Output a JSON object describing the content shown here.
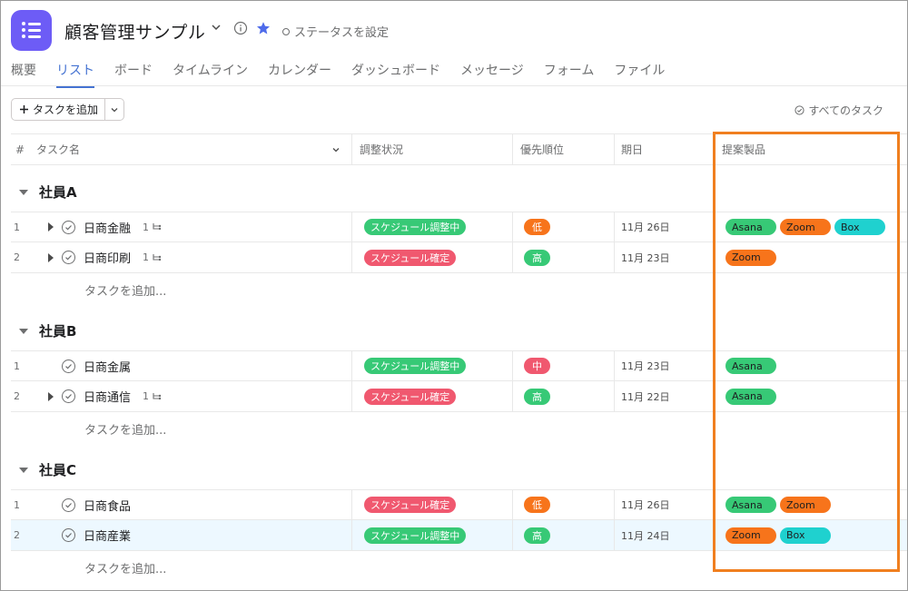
{
  "header": {
    "title": "顧客管理サンプル",
    "status_label": "ステータスを設定"
  },
  "tabs": [
    {
      "label": "概要",
      "active": false
    },
    {
      "label": "リスト",
      "active": true
    },
    {
      "label": "ボード",
      "active": false
    },
    {
      "label": "タイムライン",
      "active": false
    },
    {
      "label": "カレンダー",
      "active": false
    },
    {
      "label": "ダッシュボード",
      "active": false
    },
    {
      "label": "メッセージ",
      "active": false
    },
    {
      "label": "フォーム",
      "active": false
    },
    {
      "label": "ファイル",
      "active": false
    }
  ],
  "toolbar": {
    "add_task_label": "タスクを追加",
    "all_tasks_label": "すべてのタスク"
  },
  "columns": {
    "num": "#",
    "task": "タスク名",
    "status": "調整状況",
    "priority": "優先順位",
    "due": "期日",
    "products": "提案製品"
  },
  "add_task_row_label": "タスクを追加...",
  "colors": {
    "accent": "#4573d2",
    "highlight": "#f07f1f",
    "status_green": "#37c976",
    "status_red": "#f0586f",
    "orange": "#f7741b",
    "teal": "#1fd1cf"
  },
  "sections": [
    {
      "title": "社員A",
      "tasks": [
        {
          "num": "1",
          "name": "日商金融",
          "expandable": true,
          "subtasks": "1",
          "status": "スケジュール調整中",
          "status_color": "#37c976",
          "priority": "低",
          "priority_color": "#f7741b",
          "due": "11月 26日",
          "products": [
            {
              "name": "Asana",
              "color": "#37c976"
            },
            {
              "name": "Zoom",
              "color": "#f7741b"
            },
            {
              "name": "Box",
              "color": "#1fd1cf"
            }
          ]
        },
        {
          "num": "2",
          "name": "日商印刷",
          "expandable": true,
          "subtasks": "1",
          "status": "スケジュール確定",
          "status_color": "#f0586f",
          "priority": "高",
          "priority_color": "#37c976",
          "due": "11月 23日",
          "products": [
            {
              "name": "Zoom",
              "color": "#f7741b"
            }
          ]
        }
      ]
    },
    {
      "title": "社員B",
      "tasks": [
        {
          "num": "1",
          "name": "日商金属",
          "expandable": false,
          "subtasks": "",
          "status": "スケジュール調整中",
          "status_color": "#37c976",
          "priority": "中",
          "priority_color": "#f0586f",
          "due": "11月 23日",
          "products": [
            {
              "name": "Asana",
              "color": "#37c976"
            }
          ]
        },
        {
          "num": "2",
          "name": "日商通信",
          "expandable": true,
          "subtasks": "1",
          "status": "スケジュール確定",
          "status_color": "#f0586f",
          "priority": "高",
          "priority_color": "#37c976",
          "due": "11月 22日",
          "products": [
            {
              "name": "Asana",
              "color": "#37c976"
            }
          ]
        }
      ]
    },
    {
      "title": "社員C",
      "tasks": [
        {
          "num": "1",
          "name": "日商食品",
          "expandable": false,
          "subtasks": "",
          "status": "スケジュール確定",
          "status_color": "#f0586f",
          "priority": "低",
          "priority_color": "#f7741b",
          "due": "11月 26日",
          "products": [
            {
              "name": "Asana",
              "color": "#37c976"
            },
            {
              "name": "Zoom",
              "color": "#f7741b"
            }
          ]
        },
        {
          "num": "2",
          "name": "日商産業",
          "expandable": false,
          "subtasks": "",
          "status": "スケジュール調整中",
          "status_color": "#37c976",
          "priority": "高",
          "priority_color": "#37c976",
          "due": "11月 24日",
          "products": [
            {
              "name": "Zoom",
              "color": "#f7741b"
            },
            {
              "name": "Box",
              "color": "#1fd1cf"
            }
          ],
          "highlighted": true
        }
      ]
    }
  ]
}
